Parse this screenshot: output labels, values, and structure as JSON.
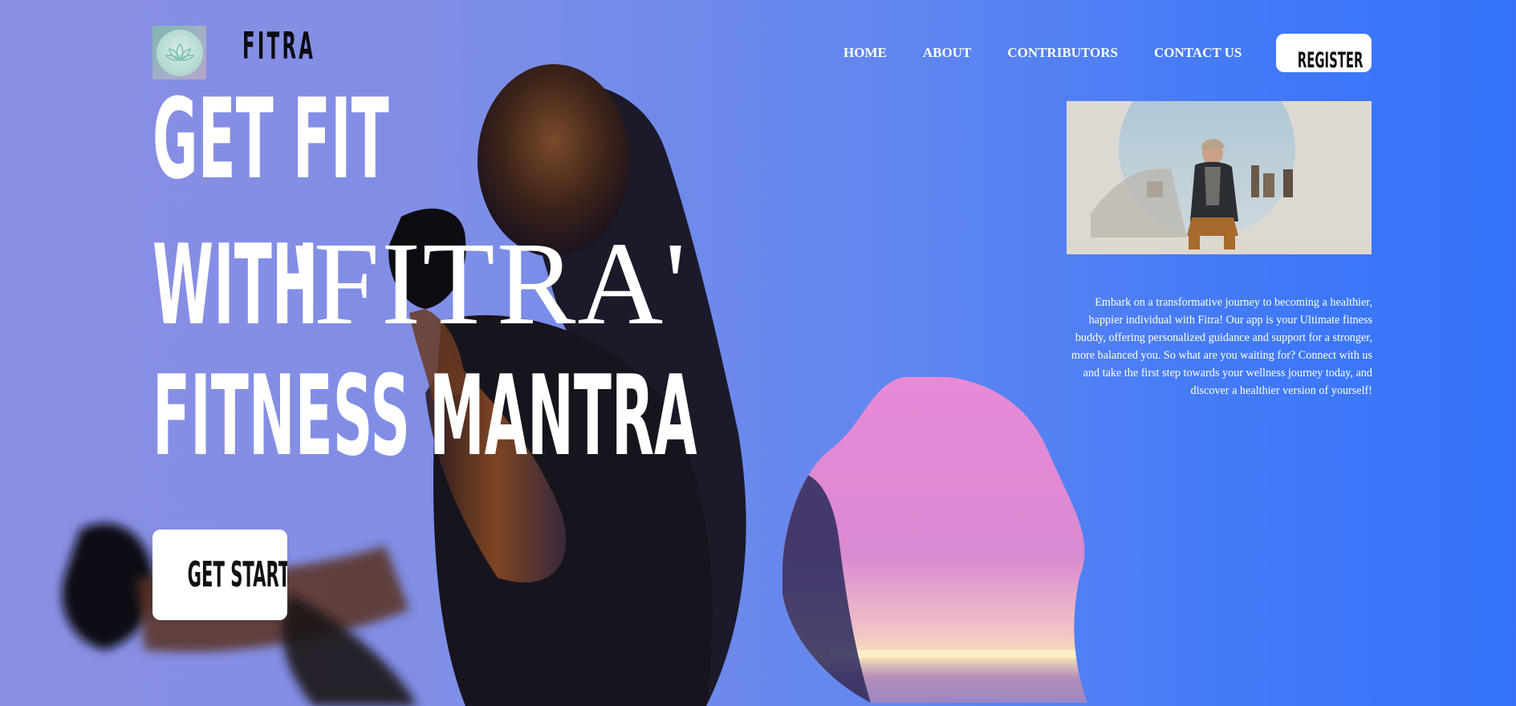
{
  "header": {
    "logo_icon": "lotus-icon",
    "brand": "FITRA",
    "nav": [
      "HOME",
      "ABOUT",
      "CONTRIBUTORS",
      "CONTACT US"
    ],
    "register_label": "REGISTER"
  },
  "hero": {
    "line1": "GET FIT",
    "line2_prefix": "WITH",
    "line2_highlight": "'FITRA'",
    "line3": "FITNESS MANTRA",
    "cta_label": "GET STARTED"
  },
  "aside": {
    "photo_icon": "person-sitting-photo",
    "description": "Embark on a transformative journey to becoming a healthier, happier individual with Fitra! Our app is your Ultimate fitness buddy, offering personalized guidance and support for a stronger, more balanced you. So what are you waiting for? Connect with us and take the first step towards your wellness journey today, and discover a healthier version of yourself!"
  },
  "colors": {
    "bg_left": "#8b8fe2",
    "bg_right": "#3573fb",
    "text_white": "#ffffff",
    "button_bg": "#ffffff",
    "blob_pink": "#e07fd2"
  }
}
